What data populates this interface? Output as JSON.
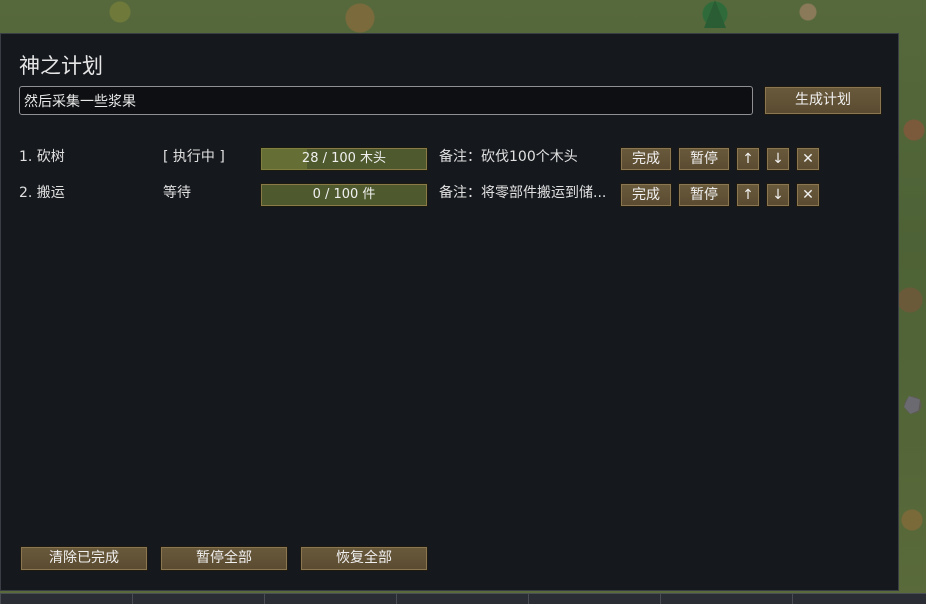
{
  "window": {
    "title": "神之计划",
    "command_input_value": "然后采集一些浆果",
    "generate_button": "生成计划"
  },
  "tasks": [
    {
      "name": "1. 砍树",
      "status": "[ 执行中 ]",
      "progress_text": "28 / 100 木头",
      "progress_fraction": 0.28,
      "note": "备注：砍伐100个木头",
      "done_label": "完成",
      "pause_label": "暂停",
      "up_label": "↑",
      "down_label": "↓",
      "delete_label": "✕"
    },
    {
      "name": "2. 搬运",
      "status": "等待",
      "progress_text": "0 / 100 件",
      "progress_fraction": 0,
      "note": "备注：将零部件搬运到储...",
      "done_label": "完成",
      "pause_label": "暂停",
      "up_label": "↑",
      "down_label": "↓",
      "delete_label": "✕"
    }
  ],
  "footer": {
    "clear_done": "清除已完成",
    "pause_all": "暂停全部",
    "resume_all": "恢复全部"
  },
  "colors": {
    "window_bg": "#15181d",
    "button_bg": "#6a5a3c",
    "progress_bg": "#4e5a2e",
    "text": "#e0e0e0"
  }
}
